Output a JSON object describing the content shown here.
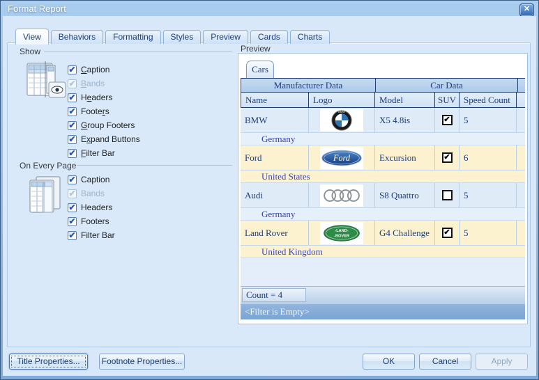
{
  "window": {
    "title": "Format Report",
    "close_glyph": "✕"
  },
  "icons": {
    "check": "✔"
  },
  "tabs": {
    "selected": "View",
    "items": [
      {
        "label": "View"
      },
      {
        "label": "Behaviors"
      },
      {
        "label": "Formatting"
      },
      {
        "label": "Styles"
      },
      {
        "label": "Preview"
      },
      {
        "label": "Cards"
      },
      {
        "label": "Charts"
      }
    ]
  },
  "show_group": {
    "title": "Show",
    "items": [
      {
        "pre": "",
        "u": "C",
        "post": "aption",
        "checked": true,
        "disabled": false
      },
      {
        "pre": "",
        "u": "B",
        "post": "ands",
        "checked": true,
        "disabled": true
      },
      {
        "pre": "H",
        "u": "e",
        "post": "aders",
        "checked": true,
        "disabled": false
      },
      {
        "pre": "Foote",
        "u": "r",
        "post": "s",
        "checked": true,
        "disabled": false
      },
      {
        "pre": "",
        "u": "G",
        "post": "roup Footers",
        "checked": true,
        "disabled": false
      },
      {
        "pre": "E",
        "u": "x",
        "post": "pand Buttons",
        "checked": true,
        "disabled": false
      },
      {
        "pre": "",
        "u": "F",
        "post": "ilter Bar",
        "checked": true,
        "disabled": false
      }
    ]
  },
  "every_page_group": {
    "title": "On Every Page",
    "items": [
      {
        "label": "Caption",
        "checked": true,
        "disabled": false
      },
      {
        "label": "Bands",
        "checked": true,
        "disabled": true
      },
      {
        "label": "Headers",
        "checked": true,
        "disabled": false
      },
      {
        "label": "Footers",
        "checked": true,
        "disabled": false
      },
      {
        "label": "Filter Bar",
        "checked": true,
        "disabled": false
      }
    ]
  },
  "preview": {
    "label": "Preview",
    "grid": {
      "caption_tab": "Cars",
      "bands": [
        "Manufacturer Data",
        "Car Data"
      ],
      "columns": [
        "Name",
        "Logo",
        "Model",
        "SUV",
        "Speed Count"
      ],
      "rows": [
        {
          "name": "BMW",
          "logo": "bmw-logo",
          "model": "X5 4.8is",
          "suv": true,
          "speed_count": "5",
          "group": "Germany"
        },
        {
          "name": "Ford",
          "logo": "ford-logo",
          "model": "Excursion",
          "suv": true,
          "speed_count": "6",
          "group": "United States"
        },
        {
          "name": "Audi",
          "logo": "audi-logo",
          "model": "S8 Quattro",
          "suv": false,
          "speed_count": "5",
          "group": "Germany"
        },
        {
          "name": "Land Rover",
          "logo": "landrover-logo",
          "model": "G4 Challenge",
          "suv": true,
          "speed_count": "5",
          "group": "United Kingdom"
        }
      ],
      "footer_summary": "Count = 4",
      "filter_bar": "<Filter is Empty>"
    }
  },
  "buttons": {
    "title_properties": "Title Properties...",
    "footnote_properties": "Footnote Properties...",
    "ok": "OK",
    "cancel": "Cancel",
    "apply": "Apply"
  },
  "colors": {
    "titlebar_top": "#a9cdef",
    "titlebar_bottom": "#7fa9d8",
    "dialog_bg": "#d8e8f8",
    "tabpage_bg": "#d9e9f9",
    "grid_border_dark": "#1f3f73",
    "grid_text_navy": "#1c3c7e",
    "group_row_text": "#3742bd",
    "row_stripe_blue": "#dfecf8",
    "row_stripe_cream": "#fdf2cf",
    "filter_bar_bg": "#85abd8",
    "button_text": "#1c3f77"
  }
}
